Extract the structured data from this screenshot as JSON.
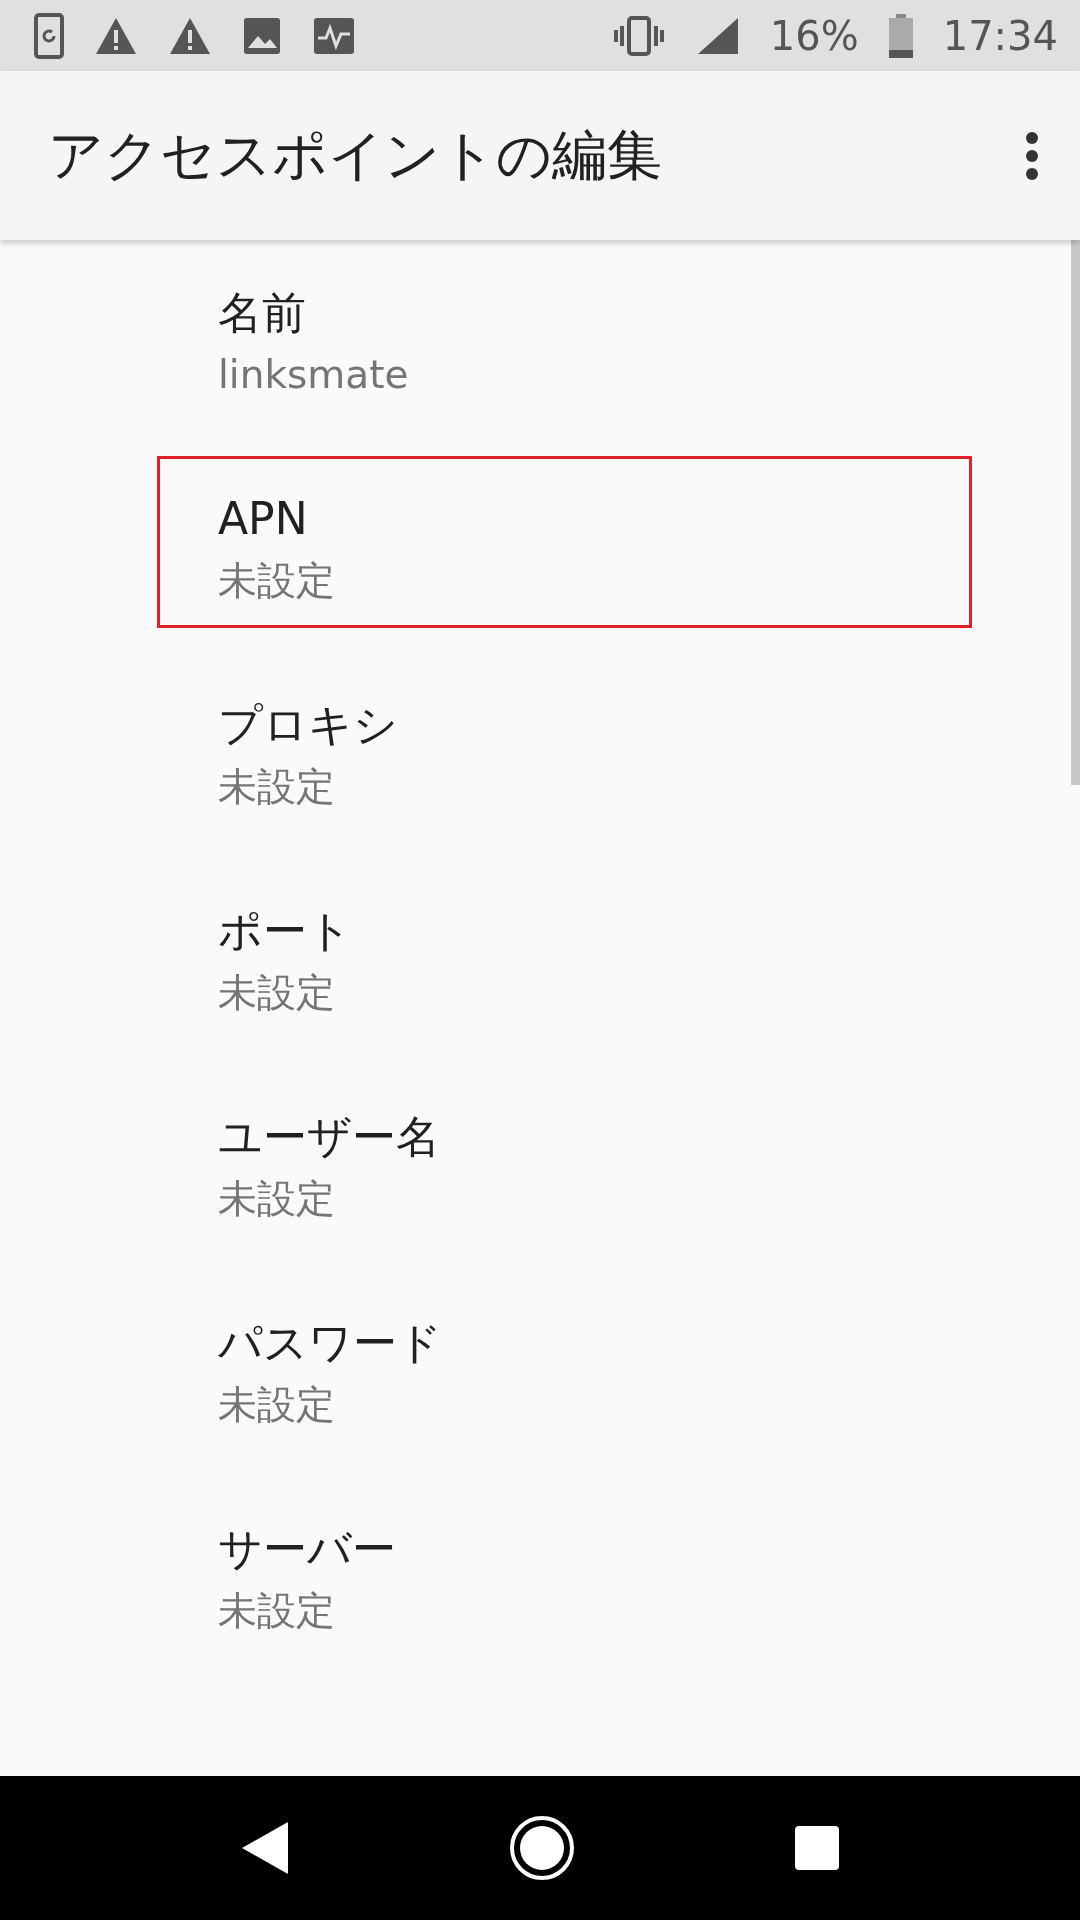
{
  "status_bar": {
    "battery": "16%",
    "time": "17:34"
  },
  "app_bar": {
    "title": "アクセスポイントの編集"
  },
  "fields": [
    {
      "label": "名前",
      "value": "linksmate",
      "highlighted": false
    },
    {
      "label": "APN",
      "value": "未設定",
      "highlighted": true
    },
    {
      "label": "プロキシ",
      "value": "未設定",
      "highlighted": false
    },
    {
      "label": "ポート",
      "value": "未設定",
      "highlighted": false
    },
    {
      "label": "ユーザー名",
      "value": "未設定",
      "highlighted": false
    },
    {
      "label": "パスワード",
      "value": "未設定",
      "highlighted": false
    },
    {
      "label": "サーバー",
      "value": "未設定",
      "highlighted": false
    }
  ]
}
